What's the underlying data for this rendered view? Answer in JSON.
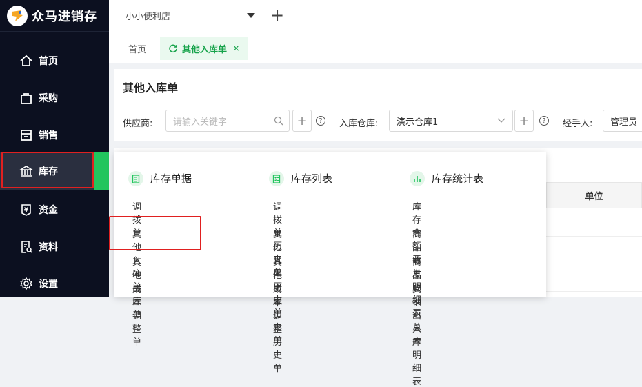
{
  "app": {
    "name": "众马进销存"
  },
  "sidebar": {
    "items": [
      {
        "label": "首页",
        "icon": "home-icon"
      },
      {
        "label": "采购",
        "icon": "bag-icon"
      },
      {
        "label": "销售",
        "icon": "store-icon"
      },
      {
        "label": "库存",
        "icon": "bank-icon"
      },
      {
        "label": "资金",
        "icon": "yen-icon"
      },
      {
        "label": "资料",
        "icon": "doc-search-icon"
      },
      {
        "label": "设置",
        "icon": "gear-icon"
      }
    ],
    "active": "库存"
  },
  "topbar": {
    "store": "小小便利店",
    "add": "+"
  },
  "tabs": {
    "home": "首页",
    "current": "其他入库单",
    "close": "×"
  },
  "page": {
    "title": "其他入库单",
    "supplier_label": "供应商:",
    "supplier_placeholder": "请输入关键字",
    "warehouse_label": "入库仓库:",
    "warehouse_value": "演示仓库1",
    "handler_label": "经手人:",
    "handler_value": "管理员",
    "help": "?"
  },
  "table": {
    "unit_header": "单位"
  },
  "menu": {
    "col1": {
      "title": "库存单据",
      "items": [
        "调拨单",
        "其他入库单",
        "其他出库单",
        "成本调整单"
      ]
    },
    "col2": {
      "title": "库存列表",
      "items": [
        "调拨单历史单",
        "其他入库历史单",
        "其他出库历史单",
        "成本调整历史单"
      ]
    },
    "col3": {
      "title": "库存统计表",
      "items": [
        "库存余额表",
        "商品收发明细表",
        "商品收发汇总表",
        "其他出入库明细表"
      ]
    }
  },
  "colors": {
    "accent": "#22c55e",
    "sidebar_bg": "#0c1020",
    "highlight": "#e02020"
  }
}
